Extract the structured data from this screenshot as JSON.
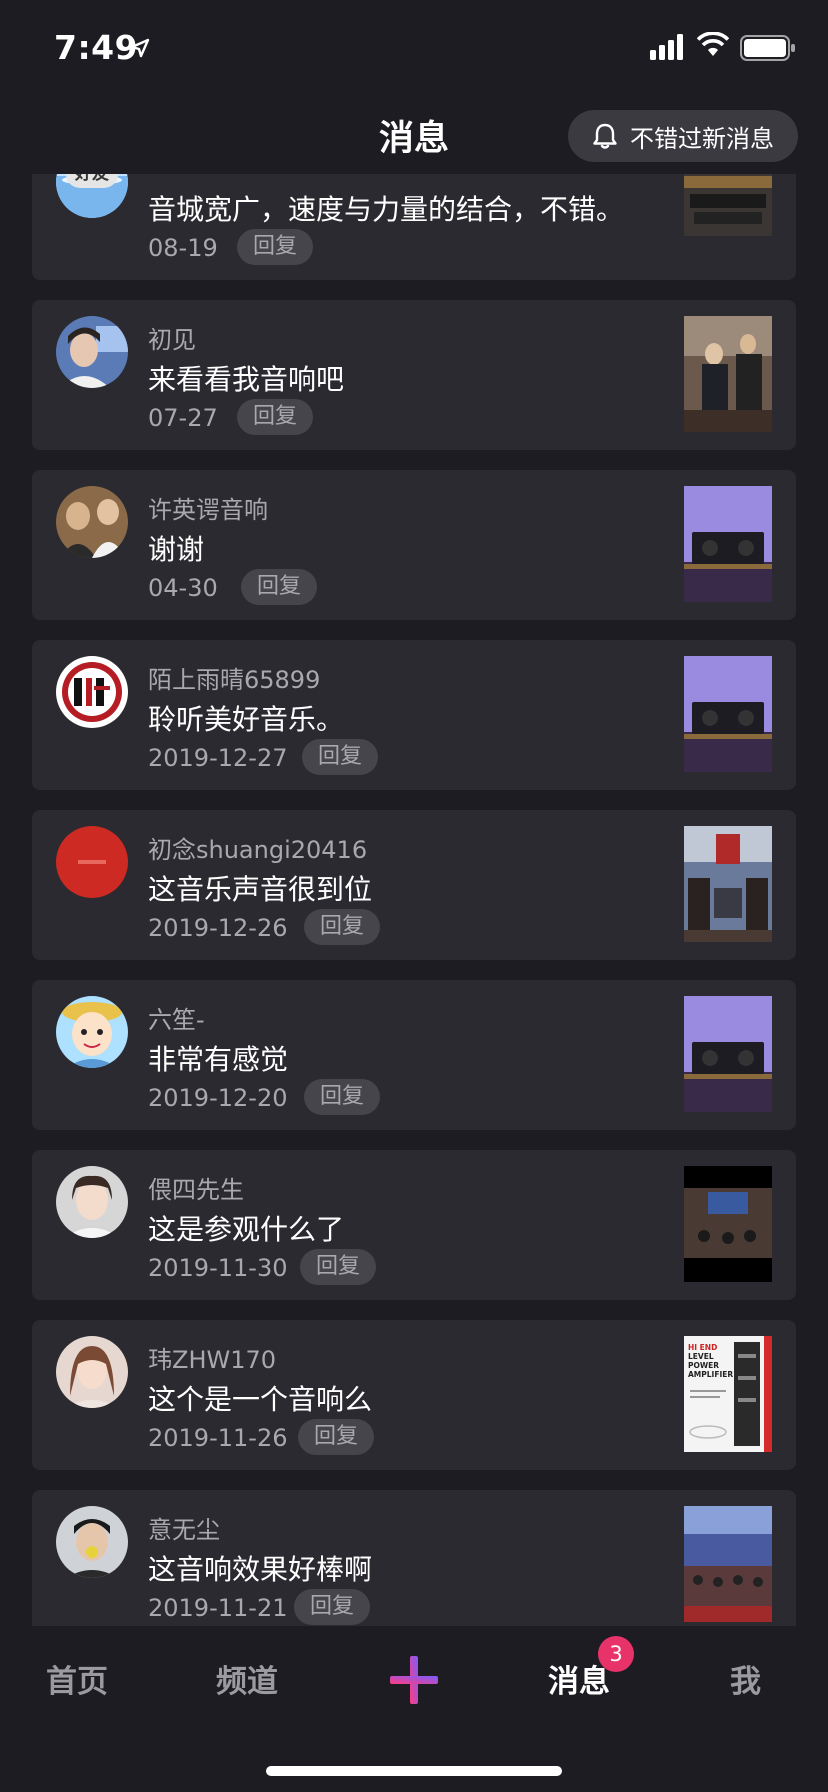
{
  "status_bar": {
    "time": "7:49"
  },
  "nav": {
    "title": "消息",
    "notify_button": "不错过新消息"
  },
  "messages": [
    {
      "name": "",
      "text": "音城宽广，速度与力量的结合，不错。",
      "date": "08-19",
      "reply": "回复",
      "friend_tag": "好友"
    },
    {
      "name": "初见",
      "text": "来看看我音响吧",
      "date": "07-27",
      "reply": "回复"
    },
    {
      "name": "许英谔音响",
      "text": "谢谢",
      "date": "04-30",
      "reply": "回复"
    },
    {
      "name": "陌上雨晴65899",
      "text": "聆听美好音乐。",
      "date": "2019-12-27",
      "reply": "回复"
    },
    {
      "name": "初念shuangi20416",
      "text": "这音乐声音很到位",
      "date": "2019-12-26",
      "reply": "回复"
    },
    {
      "name": "六笙-",
      "text": "非常有感觉",
      "date": "2019-12-20",
      "reply": "回复"
    },
    {
      "name": "偎四先生",
      "text": "这是参观什么了",
      "date": "2019-11-30",
      "reply": "回复"
    },
    {
      "name": "玮ZHW170",
      "text": "这个是一个音响么",
      "date": "2019-11-26",
      "reply": "回复"
    },
    {
      "name": "意无尘",
      "text": "这音响效果好棒啊",
      "date": "2019-11-21",
      "reply": "回复"
    }
  ],
  "thumb_text": {
    "poster": "HI END\nLEVEL\nPOWER\nAMPLIFIER"
  },
  "tabbar": {
    "home": "首页",
    "channel": "频道",
    "messages": "消息",
    "me": "我",
    "badge": "3"
  },
  "colors": {
    "background": "#1c1c22",
    "card": "#2a2a30",
    "badge": "#e8326a",
    "plus_start": "#7b5cff",
    "plus_end": "#ff3d7f"
  }
}
